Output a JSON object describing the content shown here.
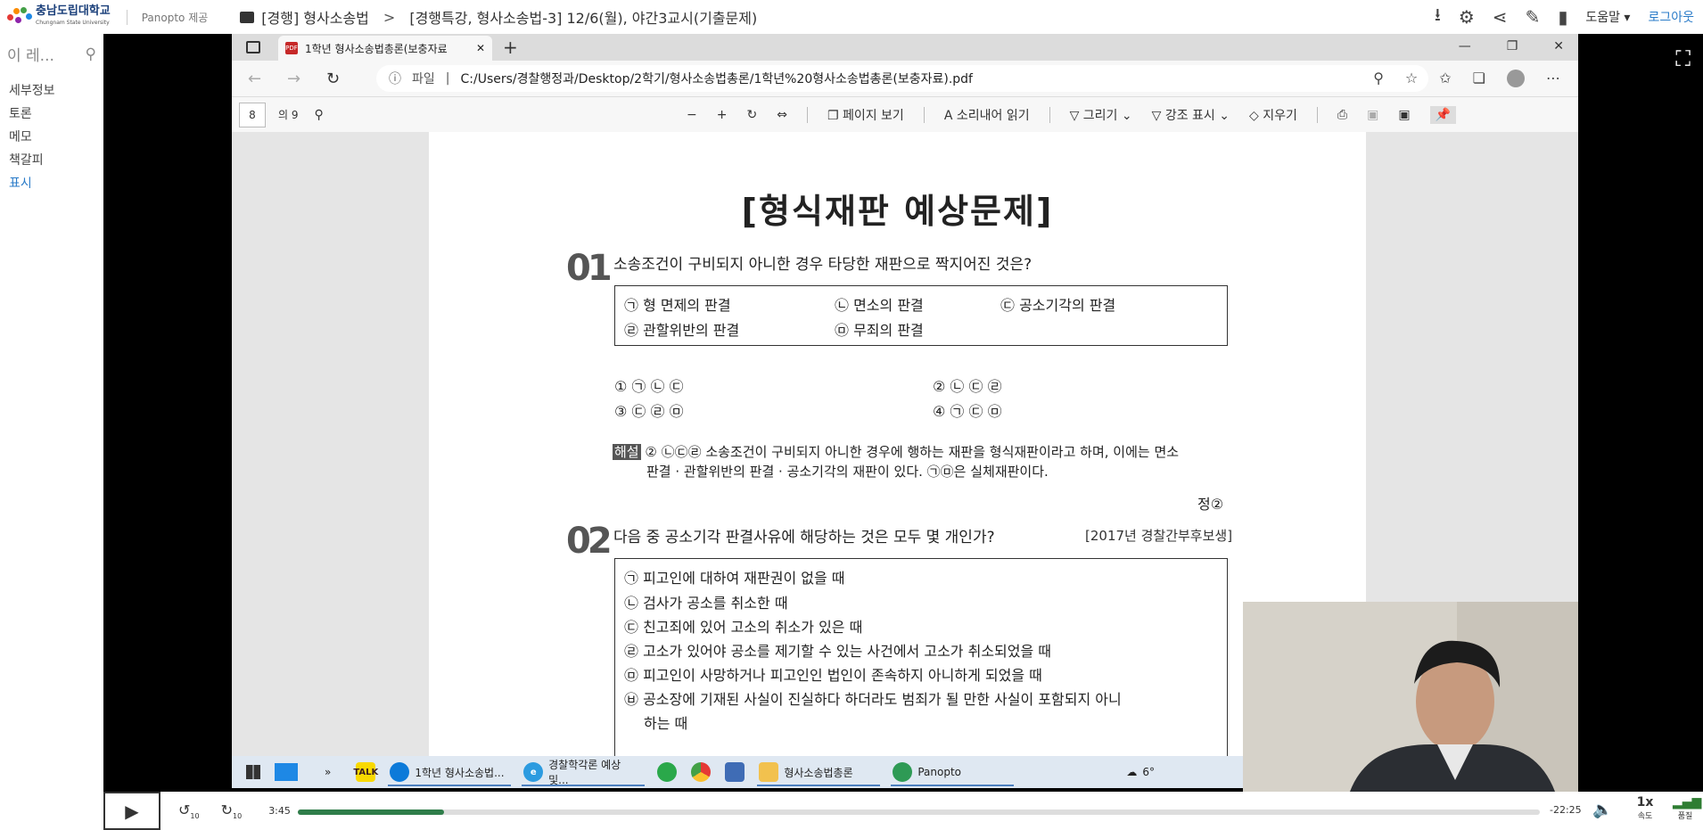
{
  "topbar": {
    "logo_text": "충남도립대학교",
    "logo_sub": "Chungnam State University",
    "provided": "Panopto 제공",
    "folder": "[경행] 형사소송법",
    "separator": ">",
    "session": "[경행특강, 형사소송법-3] 12/6(월), 야간3교시(기출문제)",
    "help": "도움말 ▾",
    "login": "로그아웃"
  },
  "sidebar": {
    "search_placeholder": "이 레...",
    "items": [
      "세부정보",
      "토론",
      "메모",
      "책갈피",
      "표시"
    ]
  },
  "browser": {
    "tab_title": "1학년 형사소송법총론(보충자료",
    "url_label": "파일",
    "url": "C:/Users/경찰행정과/Desktop/2학기/형사소송법총론/1학년%20형사소송법총론(보충자료).pdf"
  },
  "pdf_toolbar": {
    "page_num": "8",
    "page_total": "의 9",
    "page_view": "페이지 보기",
    "read_aloud": "소리내어 읽기",
    "draw": "그리기",
    "highlight": "강조 표시",
    "erase": "지우기"
  },
  "page": {
    "title": "[형식재판 예상문제]",
    "q1": {
      "num": "01",
      "text": "소송조건이 구비되지 아니한 경우 타당한 재판으로 짝지어진 것은?",
      "box": [
        "㉠ 형 면제의 판결",
        "㉡ 면소의 판결",
        "㉢ 공소기각의 판결",
        "㉣ 관할위반의 판결",
        "㉤ 무죄의 판결"
      ],
      "options": [
        "① ㉠ ㉡ ㉢",
        "② ㉡ ㉢ ㉣",
        "③ ㉢ ㉣ ㉤",
        "④ ㉠ ㉢ ㉤"
      ],
      "expl_tag": "해설",
      "expl_line1": "② ㉡㉢㉣ 소송조건이 구비되지 아니한 경우에 행하는 재판을 형식재판이라고 하며, 이에는 면소",
      "expl_line2": "판결 · 관할위반의 판결 · 공소기각의 재판이 있다. ㉠㉤은 실체재판이다.",
      "answer": "정②"
    },
    "q2": {
      "num": "02",
      "text": "다음 중 공소기각 판결사유에 해당하는 것은 모두 몇 개인가?",
      "source": "[2017년 경찰간부후보생]",
      "items": [
        "㉠ 피고인에 대하여 재판권이 없을 때",
        "㉡ 검사가 공소를 취소한 때",
        "㉢ 친고죄에 있어 고소의 취소가 있은 때",
        "㉣ 고소가 있어야 공소를 제기할 수 있는 사건에서 고소가 취소되었을 때",
        "㉤ 피고인이 사망하거나 피고인인 법인이 존속하지 아니하게 되었을 때",
        "㉥ 공소장에 기재된 사실이 진실하다 하더라도 범죄가 될 만한 사실이 포함되지 아니",
        "하는 때"
      ]
    }
  },
  "taskbar": {
    "items": [
      "1학년 형사소송법...",
      "경찰학각론 예상 및...",
      "형사소송법총론",
      "Panopto"
    ],
    "weather": "6°"
  },
  "player": {
    "elapsed": "3:45",
    "remaining": "-22:25",
    "progress": 0.118,
    "speed": "1x",
    "speed_label": "속도",
    "quality_label": "품질",
    "skip_back": "10",
    "skip_fwd": "10"
  }
}
